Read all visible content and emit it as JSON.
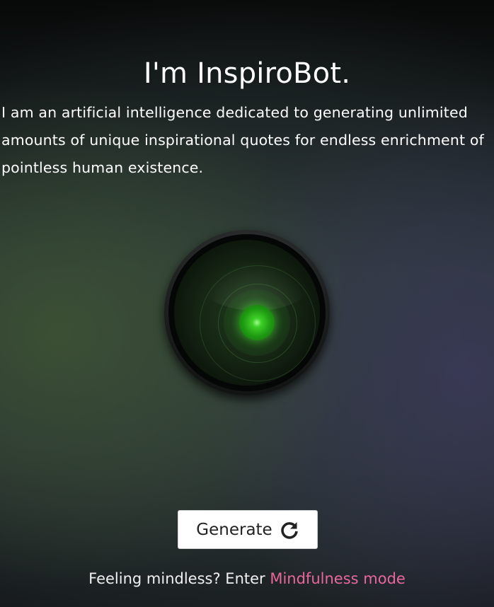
{
  "header": {
    "title": "I'm InspiroBot."
  },
  "intro": {
    "text": "I am an artificial intelligence dedicated to generating unlimited amounts of unique inspirational quotes for endless enrichment of pointless human existence."
  },
  "bot": {
    "icon": "bot-eye-icon",
    "eye_color": "#3fcf28"
  },
  "actions": {
    "generate_label": "Generate",
    "generate_icon": "refresh-icon"
  },
  "footer": {
    "prompt_text": "Feeling mindless? Enter ",
    "link_text": "Mindfulness mode",
    "link_color": "#e8679c"
  }
}
